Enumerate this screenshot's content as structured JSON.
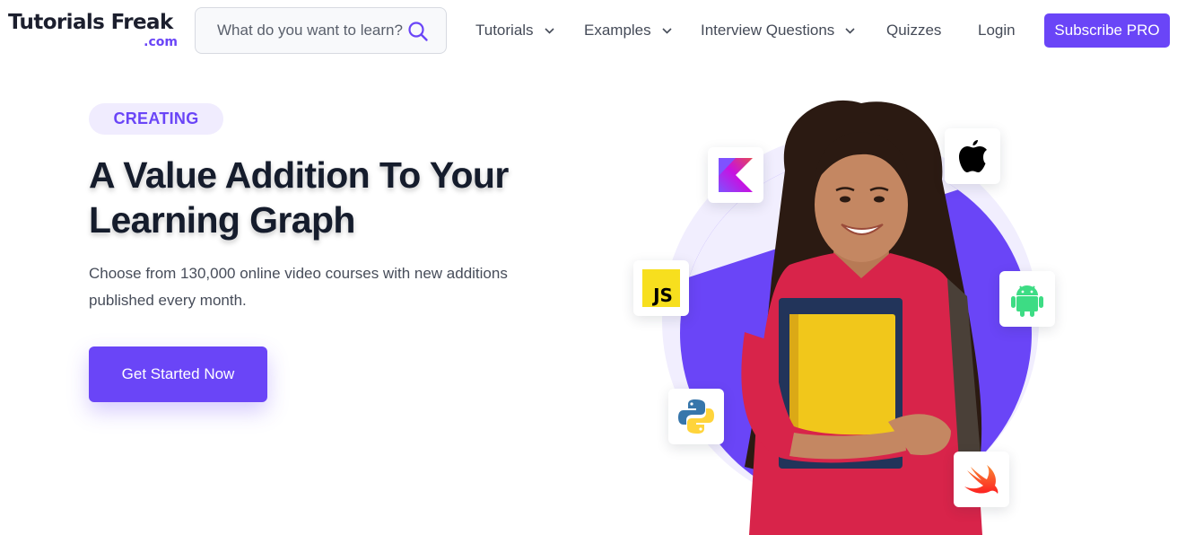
{
  "header": {
    "logo": {
      "main": "Tutorials Freak",
      "sub": ".com"
    },
    "search": {
      "placeholder": "What do you want to learn?"
    },
    "nav": [
      {
        "label": "Tutorials",
        "dropdown": true
      },
      {
        "label": "Examples",
        "dropdown": true
      },
      {
        "label": "Interview Questions",
        "dropdown": true
      },
      {
        "label": "Quizzes",
        "dropdown": false
      },
      {
        "label": "Login",
        "dropdown": false
      }
    ],
    "subscribe_label": "Subscribe PRO"
  },
  "hero": {
    "badge": "CREATING",
    "headline_line1": "A Value Addition To Your",
    "headline_line2": "Learning Graph",
    "subtext_line1": "Choose from 130,000 online video courses with new additions",
    "subtext_line2": "published every month.",
    "cta_label": "Get Started Now",
    "tech_cards": [
      {
        "name": "kotlin-icon"
      },
      {
        "name": "apple-icon"
      },
      {
        "name": "javascript-icon",
        "text": "JS"
      },
      {
        "name": "android-icon"
      },
      {
        "name": "python-icon"
      },
      {
        "name": "swift-icon"
      }
    ]
  },
  "colors": {
    "brand": "#6a45f7",
    "badge_bg": "#f0ecfe",
    "heading": "#151c2c",
    "body_text": "#474d5a"
  }
}
